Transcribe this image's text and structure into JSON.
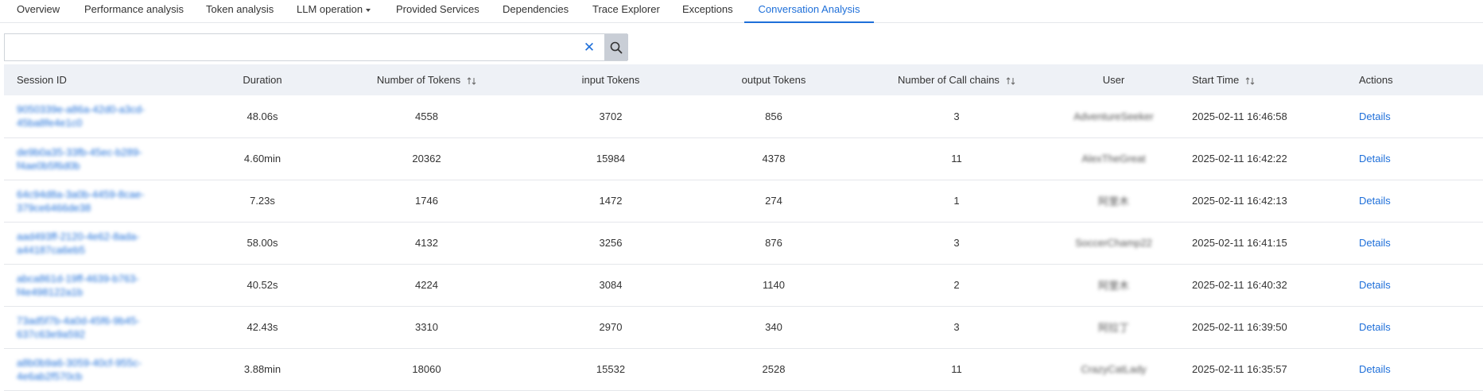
{
  "tabs": [
    {
      "label": "Overview",
      "active": false
    },
    {
      "label": "Performance analysis",
      "active": false
    },
    {
      "label": "Token analysis",
      "active": false
    },
    {
      "label": "LLM operation",
      "active": false
    },
    {
      "label": "Provided Services",
      "active": false
    },
    {
      "label": "Dependencies",
      "active": false
    },
    {
      "label": "Trace Explorer",
      "active": false
    },
    {
      "label": "Exceptions",
      "active": false
    },
    {
      "label": "Conversation Analysis",
      "active": true
    }
  ],
  "search": {
    "value": "",
    "placeholder": ""
  },
  "columns": {
    "session_id": "Session ID",
    "duration": "Duration",
    "num_tokens": "Number of Tokens",
    "input_tokens": "input Tokens",
    "output_tokens": "output Tokens",
    "call_chains": "Number of Call chains",
    "user": "User",
    "start_time": "Start Time",
    "actions": "Actions"
  },
  "rows": [
    {
      "sid1": "9050339e-a86a-42d0-a3cd-",
      "sid2": "45ba8fe4e1c0",
      "duration": "48.06s",
      "tokens": "4558",
      "input": "3702",
      "output": "856",
      "chains": "3",
      "user": "AdventureSeeker",
      "start": "2025-02-11 16:46:58",
      "action": "Details"
    },
    {
      "sid1": "de9b0a35-33fb-45ec-b289-",
      "sid2": "f4ae0b5f6d0b",
      "duration": "4.60min",
      "tokens": "20362",
      "input": "15984",
      "output": "4378",
      "chains": "11",
      "user": "AlexTheGreat",
      "start": "2025-02-11 16:42:22",
      "action": "Details"
    },
    {
      "sid1": "64c94d8a-3a0b-4459-8cae-",
      "sid2": "379ce6466de38",
      "duration": "7.23s",
      "tokens": "1746",
      "input": "1472",
      "output": "274",
      "chains": "1",
      "user": "阿里木",
      "start": "2025-02-11 16:42:13",
      "action": "Details"
    },
    {
      "sid1": "aad493ff-2120-4e62-8ada-",
      "sid2": "a44187ca6eb5",
      "duration": "58.00s",
      "tokens": "4132",
      "input": "3256",
      "output": "876",
      "chains": "3",
      "user": "SoccerChamp22",
      "start": "2025-02-11 16:41:15",
      "action": "Details"
    },
    {
      "sid1": "abca861d-19ff-4639-b763-",
      "sid2": "f4e498122a1b",
      "duration": "40.52s",
      "tokens": "4224",
      "input": "3084",
      "output": "1140",
      "chains": "2",
      "user": "阿里木",
      "start": "2025-02-11 16:40:32",
      "action": "Details"
    },
    {
      "sid1": "73ad5f7b-4a0d-45f6-9b45-",
      "sid2": "637c63e9a592",
      "duration": "42.43s",
      "tokens": "3310",
      "input": "2970",
      "output": "340",
      "chains": "3",
      "user": "阿拉丁",
      "start": "2025-02-11 16:39:50",
      "action": "Details"
    },
    {
      "sid1": "a8b0b9a6-3059-40cf-955c-",
      "sid2": "4e6ab2f570cb",
      "duration": "3.88min",
      "tokens": "18060",
      "input": "15532",
      "output": "2528",
      "chains": "11",
      "user": "CrazyCatLady",
      "start": "2025-02-11 16:35:57",
      "action": "Details"
    }
  ],
  "colors": {
    "accent": "#1e6fd9",
    "header_bg": "#eef1f6",
    "border": "#e5e7eb"
  }
}
